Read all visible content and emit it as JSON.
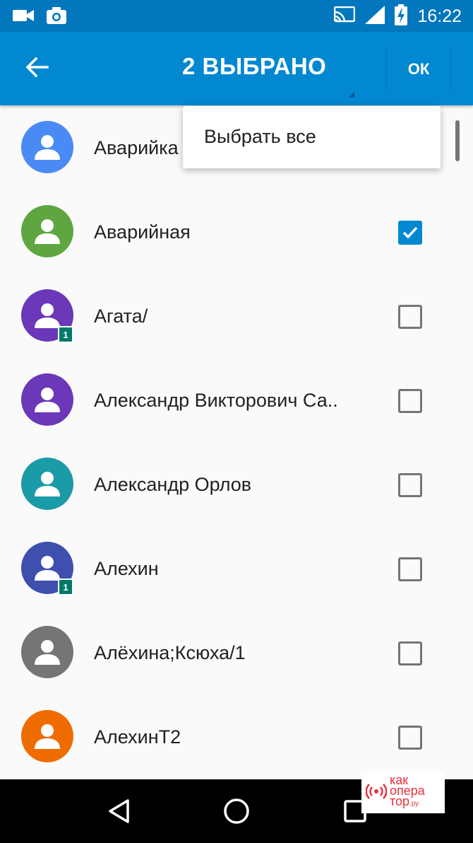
{
  "status_bar": {
    "time": "16:22",
    "left_icons": [
      "video-camera-icon",
      "camera-icon"
    ],
    "right_icons": [
      "cast-icon",
      "signal-icon",
      "battery-charging-icon"
    ]
  },
  "app_bar": {
    "title": "2 ВЫБРАНО",
    "ok_label": "ОК",
    "color": "#0288d1"
  },
  "overflow_menu": {
    "items": [
      {
        "label": "Выбрать все"
      }
    ]
  },
  "contacts": [
    {
      "name": "Аварийка",
      "avatar_color": "#4a8af4",
      "checked": true,
      "badge": ""
    },
    {
      "name": "Аварийная",
      "avatar_color": "#5fa540",
      "checked": true,
      "badge": ""
    },
    {
      "name": "Агата/",
      "avatar_color": "#6a38b8",
      "checked": false,
      "badge": "1"
    },
    {
      "name": "Александр Викторович Са..",
      "avatar_color": "#6a38b8",
      "checked": false,
      "badge": ""
    },
    {
      "name": "Александр Орлов",
      "avatar_color": "#1b9aa8",
      "checked": false,
      "badge": ""
    },
    {
      "name": "Алехин",
      "avatar_color": "#3f4fae",
      "checked": false,
      "badge": "1"
    },
    {
      "name": "Алёхина;Ксюха/1",
      "avatar_color": "#757575",
      "checked": false,
      "badge": ""
    },
    {
      "name": "АлехинТ2",
      "avatar_color": "#ef6c00",
      "checked": false,
      "badge": ""
    }
  ],
  "nav_bar": {
    "buttons": [
      "back-triangle-icon",
      "home-circle-icon",
      "recents-square-icon"
    ]
  },
  "watermark": {
    "lines": [
      "как",
      "опера",
      "тор"
    ],
    "suffix": ".ру"
  }
}
